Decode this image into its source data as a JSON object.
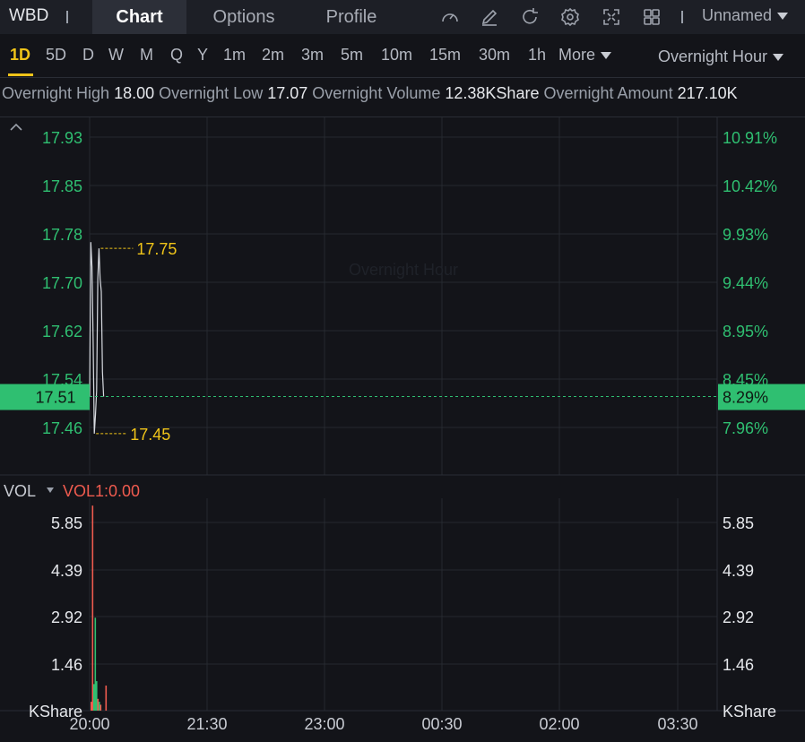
{
  "header": {
    "ticker": "WBD",
    "tabs": [
      {
        "label": "Chart",
        "active": true
      },
      {
        "label": "Options",
        "active": false
      },
      {
        "label": "Profile",
        "active": false
      }
    ],
    "tools": [
      "gauge-icon",
      "pencil-icon",
      "refresh-icon",
      "gear-icon",
      "fullscreen-icon",
      "grid-icon"
    ],
    "layout_name": "Unnamed"
  },
  "timeframes": {
    "items": [
      "1D",
      "5D",
      "D",
      "W",
      "M",
      "Q",
      "Y",
      "1m",
      "2m",
      "3m",
      "5m",
      "10m",
      "15m",
      "30m",
      "1h"
    ],
    "active": "1D",
    "more_label": "More",
    "session_select": "Overnight Hour"
  },
  "stats": [
    {
      "label": "Overnight High",
      "value": "18.00"
    },
    {
      "label": "Overnight Low",
      "value": "17.07"
    },
    {
      "label": "Overnight Volume",
      "value": "12.38KShare"
    },
    {
      "label": "Overnight Amount",
      "value": "217.10K"
    }
  ],
  "colors": {
    "up": "#2fbf71",
    "down": "#ef5b4f",
    "highlight": "#f0c419",
    "price_line": "#2fbf71",
    "current_tag": "#2fbf71"
  },
  "chart_data": [
    {
      "type": "line",
      "watermark": "Overnight Hour",
      "x_ticks": [
        "20:00",
        "21:30",
        "23:00",
        "00:30",
        "02:00",
        "03:30"
      ],
      "y_left_ticks": [
        "17.93",
        "17.85",
        "17.78",
        "17.70",
        "17.62",
        "17.54",
        "17.46"
      ],
      "y_right_ticks": [
        "10.91%",
        "10.42%",
        "9.93%",
        "9.44%",
        "8.95%",
        "8.45%",
        "7.96%"
      ],
      "ylim": [
        17.4,
        17.97
      ],
      "current_price": "17.51",
      "current_pct": "8.29%",
      "max_label": "17.75",
      "min_label": "17.45",
      "series": [
        {
          "x": [
            0,
            1,
            2,
            3,
            4,
            5,
            6,
            7,
            8,
            9,
            10,
            11,
            12
          ],
          "y": [
            17.51,
            17.76,
            17.72,
            17.6,
            17.45,
            17.48,
            17.52,
            17.7,
            17.75,
            17.7,
            17.68,
            17.55,
            17.51
          ]
        }
      ],
      "grid": true
    },
    {
      "type": "bar",
      "indicator_label": "VOL",
      "indicator_value": "VOL1:0.00",
      "unit": "KShare",
      "y_ticks": [
        "5.85",
        "4.39",
        "2.92",
        "1.46"
      ],
      "ylim": [
        0,
        7.2
      ],
      "bars": [
        {
          "v": 0.3,
          "dir": "down"
        },
        {
          "v": 6.95,
          "dir": "down"
        },
        {
          "v": 0.9,
          "dir": "up"
        },
        {
          "v": 3.15,
          "dir": "up"
        },
        {
          "v": 1.0,
          "dir": "up"
        },
        {
          "v": 0.4,
          "dir": "down"
        },
        {
          "v": 0.3,
          "dir": "up"
        },
        {
          "v": 0.2,
          "dir": "down"
        },
        {
          "v": 0.0,
          "dir": "up"
        },
        {
          "v": 0.0,
          "dir": "up"
        },
        {
          "v": 0.0,
          "dir": "up"
        },
        {
          "v": 0.85,
          "dir": "down"
        }
      ]
    }
  ]
}
